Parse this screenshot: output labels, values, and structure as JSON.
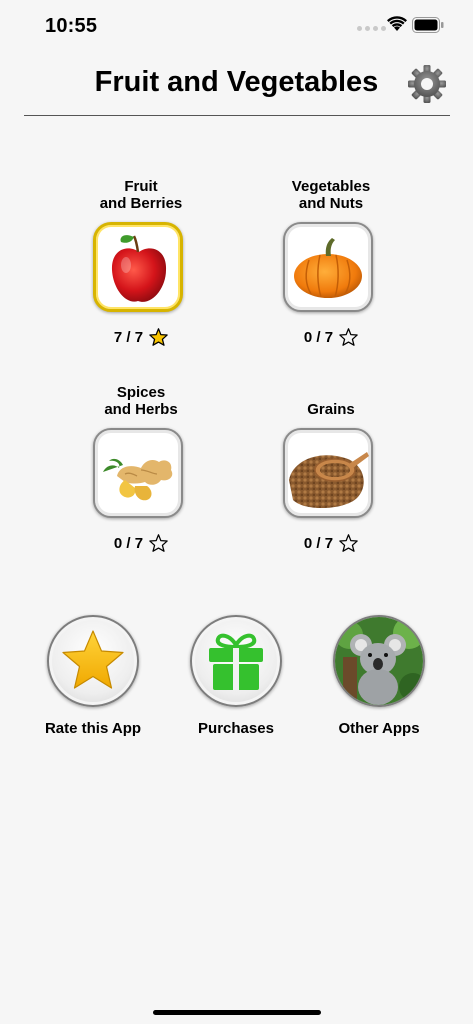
{
  "status": {
    "time": "10:55"
  },
  "header": {
    "title": "Fruit and Vegetables"
  },
  "categories": [
    {
      "label": "Fruit\nand Berries",
      "score": "7 / 7",
      "completed": true,
      "icon": "apple-icon"
    },
    {
      "label": "Vegetables\nand Nuts",
      "score": "0 / 7",
      "completed": false,
      "icon": "pumpkin-icon"
    },
    {
      "label": "Spices\nand Herbs",
      "score": "0 / 7",
      "completed": false,
      "icon": "ginger-icon"
    },
    {
      "label": "Grains",
      "score": "0 / 7",
      "completed": false,
      "icon": "buckwheat-icon"
    }
  ],
  "actions": [
    {
      "label": "Rate this App",
      "icon": "star-icon"
    },
    {
      "label": "Purchases",
      "icon": "gift-icon"
    },
    {
      "label": "Other Apps",
      "icon": "koala-icon"
    }
  ],
  "colors": {
    "star_filled": "#f7c300",
    "gift_green": "#35c12e",
    "completed_border": "#d7b400"
  }
}
